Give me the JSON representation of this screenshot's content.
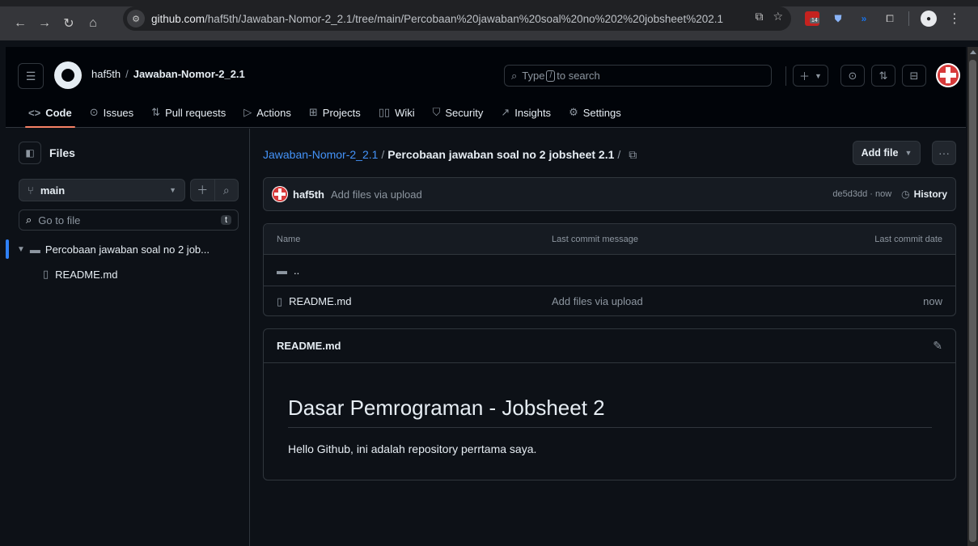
{
  "browser": {
    "url_host": "github.com",
    "url_path": "/haf5th/Jawaban-Nomor-2_2.1/tree/main/Percobaan%20jawaban%20soal%20no%202%20jobsheet%202.1",
    "calendar_badge": "14"
  },
  "header": {
    "owner": "haf5th",
    "separator": "/",
    "repo": "Jawaban-Nomor-2_2.1",
    "search_before": "Type",
    "search_key": "/",
    "search_after": "to search"
  },
  "tabs": [
    {
      "label": "Code",
      "icon": "code-icon",
      "active": true
    },
    {
      "label": "Issues",
      "icon": "issue-icon"
    },
    {
      "label": "Pull requests",
      "icon": "pull-request-icon"
    },
    {
      "label": "Actions",
      "icon": "play-icon"
    },
    {
      "label": "Projects",
      "icon": "table-icon"
    },
    {
      "label": "Wiki",
      "icon": "book-icon"
    },
    {
      "label": "Security",
      "icon": "shield-icon"
    },
    {
      "label": "Insights",
      "icon": "graph-icon"
    },
    {
      "label": "Settings",
      "icon": "gear-icon"
    }
  ],
  "sidebar": {
    "title": "Files",
    "branch": "main",
    "goto_placeholder": "Go to file",
    "goto_key": "t",
    "tree": [
      {
        "label": "Percobaan jawaban soal no 2 job...",
        "type": "folder",
        "expanded": true,
        "selected": true
      },
      {
        "label": "README.md",
        "type": "file"
      }
    ]
  },
  "breadcrumb": {
    "repo": "Jawaban-Nomor-2_2.1",
    "separator": "/",
    "current": "Percobaan jawaban soal no 2 jobsheet 2.1",
    "trailing": "/"
  },
  "actions": {
    "add_file": "Add file",
    "more": "···"
  },
  "commit": {
    "author": "haf5th",
    "message": "Add files via upload",
    "meta": "de5d3dd · now",
    "history": "History"
  },
  "table": {
    "headers": {
      "name": "Name",
      "message": "Last commit message",
      "date": "Last commit date"
    },
    "parent": "..",
    "rows": [
      {
        "name": "README.md",
        "message": "Add files via upload",
        "date": "now"
      }
    ]
  },
  "readme": {
    "filename": "README.md",
    "heading": "Dasar Pemrograman - Jobsheet 2",
    "paragraph": "Hello Github, ini adalah repository perrtama saya."
  },
  "colors": {
    "background": "#0d1117",
    "header_bg": "#010409",
    "link": "#4493f8",
    "tab_underline": "#f78166",
    "border": "#30363d",
    "muted": "#8d96a0"
  }
}
